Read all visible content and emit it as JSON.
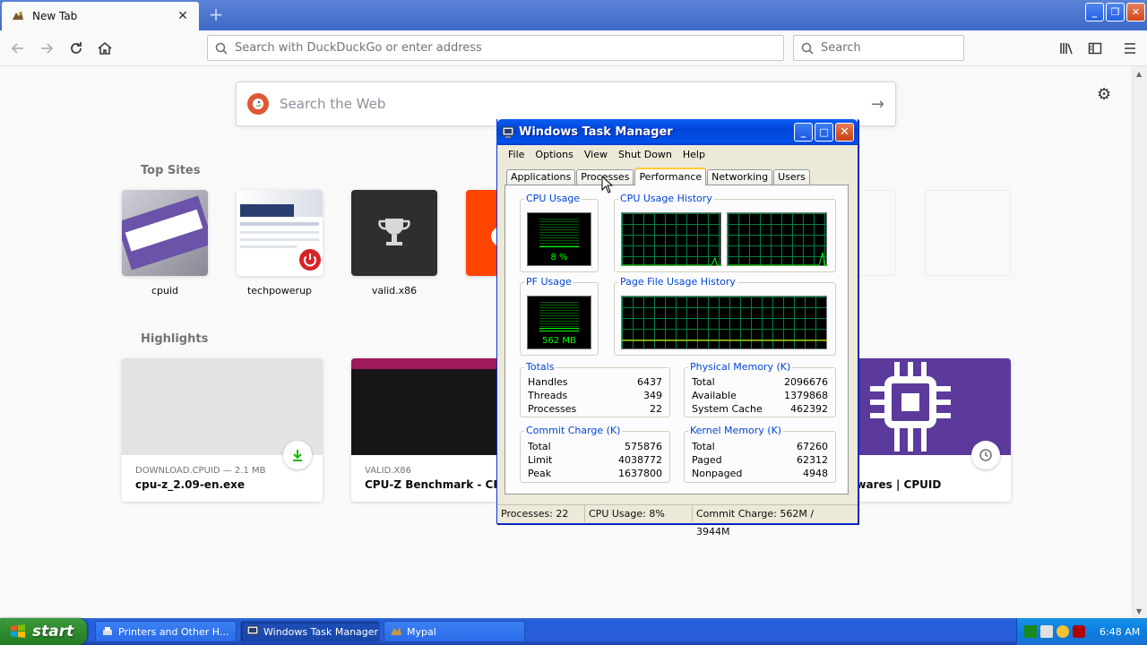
{
  "browser": {
    "tab_title": "New Tab",
    "url_placeholder": "Search with DuckDuckGo or enter address",
    "search_placeholder": "Search"
  },
  "newtab": {
    "search_placeholder": "Search the Web",
    "top_sites_title": "Top Sites",
    "top_sites": [
      {
        "label": "cpuid"
      },
      {
        "label": "techpowerup"
      },
      {
        "label": "valid.x86"
      }
    ],
    "highlights_title": "Highlights",
    "highlights": [
      {
        "context": "DOWNLOAD.CPUID — 2.1 MB",
        "title": "cpu-z_2.09-en.exe"
      },
      {
        "context": "VALID.X86",
        "title": "CPU-Z Benchmark - CPU-Z"
      },
      {
        "context": "",
        "title": "| Softwares | CPUID"
      }
    ]
  },
  "taskmgr": {
    "title": "Windows Task Manager",
    "menu": [
      "File",
      "Options",
      "View",
      "Shut Down",
      "Help"
    ],
    "tabs": [
      "Applications",
      "Processes",
      "Performance",
      "Networking",
      "Users"
    ],
    "active_tab": "Performance",
    "cpu_usage_caption": "CPU Usage",
    "cpu_usage_value": "8 %",
    "cpu_usage_percent": 8,
    "cpu_history_caption": "CPU Usage History",
    "pf_usage_caption": "PF Usage",
    "pf_usage_value": "562 MB",
    "pf_usage_percent": 14,
    "pf_history_caption": "Page File Usage History",
    "totals": {
      "caption": "Totals",
      "rows": [
        {
          "label": "Handles",
          "value": "6437"
        },
        {
          "label": "Threads",
          "value": "349"
        },
        {
          "label": "Processes",
          "value": "22"
        }
      ]
    },
    "physical": {
      "caption": "Physical Memory (K)",
      "rows": [
        {
          "label": "Total",
          "value": "2096676"
        },
        {
          "label": "Available",
          "value": "1379868"
        },
        {
          "label": "System Cache",
          "value": "462392"
        }
      ]
    },
    "commit": {
      "caption": "Commit Charge (K)",
      "rows": [
        {
          "label": "Total",
          "value": "575876"
        },
        {
          "label": "Limit",
          "value": "4038772"
        },
        {
          "label": "Peak",
          "value": "1637800"
        }
      ]
    },
    "kernel": {
      "caption": "Kernel Memory (K)",
      "rows": [
        {
          "label": "Total",
          "value": "67260"
        },
        {
          "label": "Paged",
          "value": "62312"
        },
        {
          "label": "Nonpaged",
          "value": "4948"
        }
      ]
    },
    "status": {
      "processes": "Processes: 22",
      "cpu": "CPU Usage: 8%",
      "commit": "Commit Charge: 562M / 3944M"
    }
  },
  "taskbar": {
    "start_label": "start",
    "items": [
      "Printers and Other H...",
      "Windows Task Manager",
      "Mypal"
    ],
    "clock": "6:48 AM"
  },
  "colors": {
    "xp_blue": "#0a5ef3",
    "meter_green": "#00ff00",
    "grid_green": "#008040",
    "group_caption": "#0046d5"
  }
}
